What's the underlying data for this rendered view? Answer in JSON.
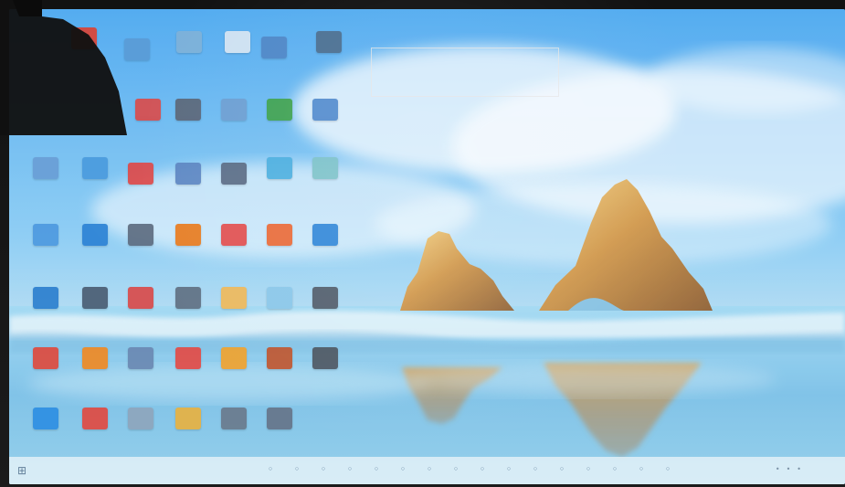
{
  "screen": {
    "accent": "#0078d7"
  },
  "desktop": {
    "icons": [
      {
        "name": "chrome-icon",
        "color": "#db4437",
        "text": ""
      },
      {
        "name": "drive-icon",
        "color": "#5a9cd6",
        "text": ""
      },
      {
        "name": "folder-icon",
        "color": "#7fb2d9",
        "text": ""
      },
      {
        "name": "document-icon",
        "color": "#d8e6f3",
        "text": ""
      },
      {
        "name": "network-icon",
        "color": "#4f86c6",
        "text": ""
      },
      {
        "name": "paint-icon",
        "color": "#4c6d8d",
        "text": ""
      },
      {
        "name": "pdf-icon",
        "color": "#d94c4c",
        "text": ""
      },
      {
        "name": "presentation-icon",
        "color": "#5c6678",
        "text": ""
      },
      {
        "name": "tool-icon",
        "color": "#6f9fd2",
        "text": ""
      },
      {
        "name": "spreadsheet-icon",
        "color": "#3fa24b",
        "text": ""
      },
      {
        "name": "remote-icon",
        "color": "#4f88cc",
        "text": ""
      },
      {
        "name": "control-panel-icon",
        "color": "#6a9fd6",
        "text": ""
      },
      {
        "name": "refresh-icon",
        "color": "#4b9bde",
        "text": ""
      },
      {
        "name": "media-icon",
        "color": "#de4a4a",
        "text": ""
      },
      {
        "name": "monitor-icon",
        "color": "#5d86c2",
        "text": ""
      },
      {
        "name": "video-icon",
        "color": "#5a6b84",
        "text": ""
      },
      {
        "name": "link-icon",
        "color": "#4cafe0",
        "text": ""
      },
      {
        "name": "book-icon",
        "color": "#7ec3c9",
        "text": ""
      },
      {
        "name": "bluetooth-icon",
        "color": "#4e9ae0",
        "text": ""
      },
      {
        "name": "store-icon",
        "color": "#2d83d5",
        "text": ""
      },
      {
        "name": "camera-icon",
        "color": "#5e6d81",
        "text": ""
      },
      {
        "name": "vlc-icon",
        "color": "#ea7b1d",
        "text": ""
      },
      {
        "name": "red-tool-icon",
        "color": "#e34d4d",
        "text": ""
      },
      {
        "name": "orange-app-icon",
        "color": "#ec6834",
        "text": ""
      },
      {
        "name": "edge-icon",
        "color": "#2f86d8",
        "text": ""
      },
      {
        "name": "edge-browser-icon",
        "color": "#2d80cf",
        "text": ""
      },
      {
        "name": "screen-icon",
        "color": "#4b5e73",
        "text": ""
      },
      {
        "name": "pdf-reader-icon",
        "color": "#d94b4b",
        "text": ""
      },
      {
        "name": "capture-icon",
        "color": "#607083",
        "text": ""
      },
      {
        "name": "settings-icon",
        "color": "#f0b95a",
        "text": ""
      },
      {
        "name": "cloud-icon",
        "color": "#8cc8ea",
        "text": ""
      },
      {
        "name": "folder-dark-icon",
        "color": "#525c69",
        "text": ""
      },
      {
        "name": "chrome-shortcut-icon",
        "color": "#de4b3f",
        "text": ""
      },
      {
        "name": "vlc-shortcut-icon",
        "color": "#ef8a25",
        "text": ""
      },
      {
        "name": "scanner-icon",
        "color": "#6b89b3",
        "text": ""
      },
      {
        "name": "adobe-icon",
        "color": "#e34c47",
        "text": ""
      },
      {
        "name": "orange-cone-icon",
        "color": "#f0a32f",
        "text": ""
      },
      {
        "name": "app-icon",
        "color": "#c0562f",
        "text": ""
      },
      {
        "name": "dark-folder-icon",
        "color": "#4d5661",
        "text": ""
      },
      {
        "name": "teamviewer-icon",
        "color": "#2e8fe3",
        "text": ""
      },
      {
        "name": "red-d-icon",
        "color": "#e04b43",
        "text": ""
      },
      {
        "name": "gear-icon",
        "color": "#8ea6bd",
        "text": ""
      },
      {
        "name": "star-icon",
        "color": "#e7b243",
        "text": ""
      },
      {
        "name": "window-icon",
        "color": "#6a7b8d",
        "text": ""
      },
      {
        "name": "app-shortcut-icon",
        "color": "#66758a",
        "text": ""
      }
    ]
  },
  "taskbar": {
    "start": "",
    "items": [
      "",
      "",
      "",
      "",
      "",
      "",
      "",
      "",
      "",
      "",
      "",
      "",
      "",
      "",
      "",
      ""
    ],
    "tray": [
      "",
      "",
      ""
    ]
  }
}
